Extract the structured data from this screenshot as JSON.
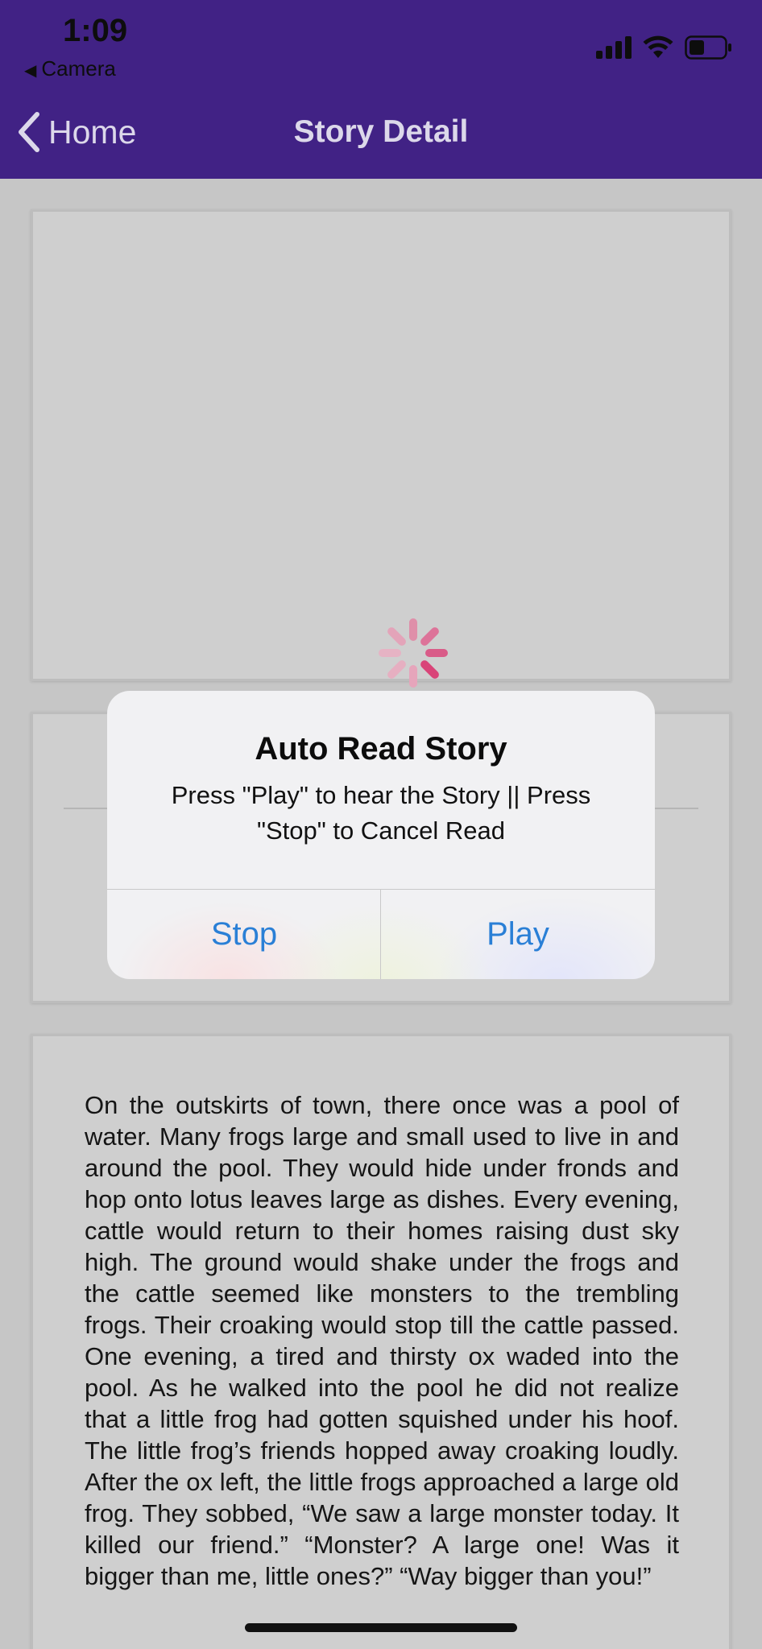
{
  "status_bar": {
    "time": "1:09",
    "back_app_label": "Camera"
  },
  "nav": {
    "back_label": "Home",
    "title": "Story Detail"
  },
  "alert": {
    "title": "Auto Read Story",
    "message": "Press \"Play\" to hear the Story || Press \"Stop\" to Cancel Read",
    "buttons": {
      "stop": "Stop",
      "play": "Play"
    }
  },
  "story": {
    "text": "On the outskirts of town, there once was a pool of water. Many frogs large and small used to live in and around the pool. They would hide under fronds and hop onto lotus leaves large as dishes. Every evening, cattle would return to their homes raising dust sky high. The ground would shake under the frogs and the cattle seemed like monsters to the trembling frogs. Their croaking would stop till the cattle passed. One evening, a tired and thirsty ox waded into the pool. As he walked into the pool he did not realize that a little frog had gotten squished under his hoof. The little frog’s friends hopped away croaking loudly. After the ox left, the little frogs approached a large old frog. They sobbed, “We saw a large monster today. It killed our friend.” “Monster? A large one! Was it bigger than me, little ones?” “Way bigger than you!”"
  },
  "colors": {
    "nav_bg": "#412285",
    "alert_button_text": "#2a7fd6",
    "spinner": "#d9497a"
  },
  "icons": {
    "back": "chevron-left-icon",
    "camera_back": "triangle-left-icon",
    "signal": "cellular-signal-icon",
    "wifi": "wifi-icon",
    "battery": "battery-icon",
    "loading": "loading-spinner-icon"
  }
}
